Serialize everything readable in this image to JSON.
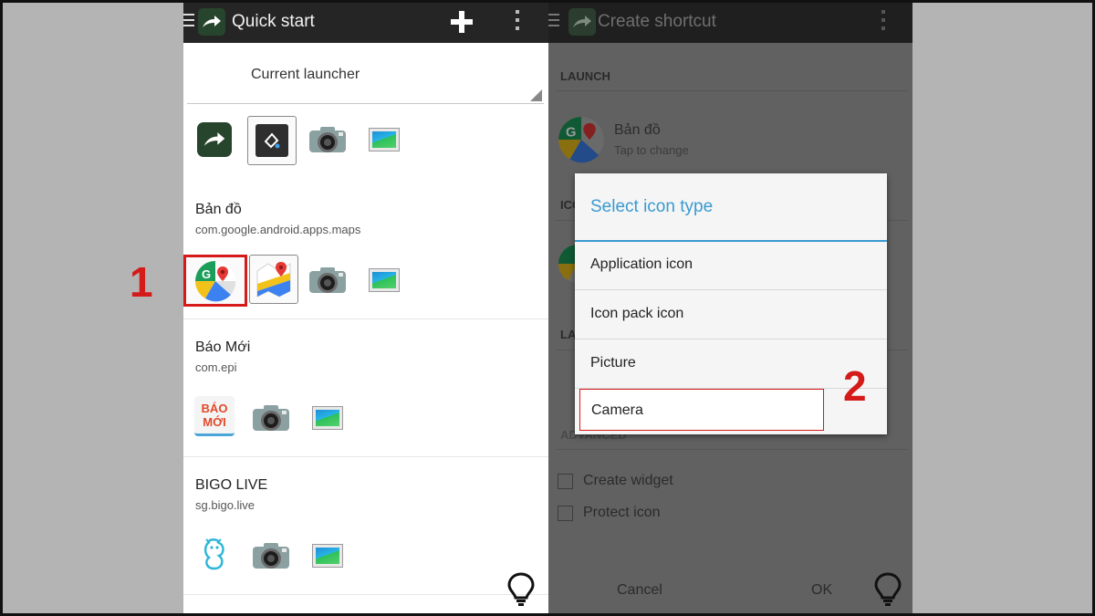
{
  "left": {
    "appbar": {
      "title": "Quick start"
    },
    "launcher": {
      "label": "Current launcher"
    },
    "apps": [
      {
        "name": "Bản đồ",
        "package": "com.google.android.apps.maps"
      },
      {
        "name": "Báo Mới",
        "package": "com.epi"
      },
      {
        "name": "BIGO LIVE",
        "package": "sg.bigo.live"
      }
    ],
    "baomoi_icon_text": {
      "line1": "BÁO",
      "line2": "MỚI"
    }
  },
  "right": {
    "appbar": {
      "title": "Create shortcut"
    },
    "launch_section": "LAUNCH",
    "app": {
      "name": "Bản đồ",
      "subtitle": "Tap to change"
    },
    "icon_section_partial": "ICO",
    "label_section_partial": "LA",
    "advanced_partial": "ADVANCED",
    "options": [
      {
        "label": "Create widget",
        "checked": false
      },
      {
        "label": "Protect icon",
        "checked": false
      }
    ],
    "buttons": {
      "cancel": "Cancel",
      "ok": "OK"
    },
    "dialog": {
      "title": "Select icon type",
      "items": [
        "Application icon",
        "Icon pack icon",
        "Picture",
        "Camera"
      ]
    }
  },
  "steps": {
    "one": "1",
    "two": "2"
  },
  "colors": {
    "highlight_red": "#d51a1a",
    "dialog_accent": "#3a9ad2",
    "app_logo_green": "#27442d"
  }
}
